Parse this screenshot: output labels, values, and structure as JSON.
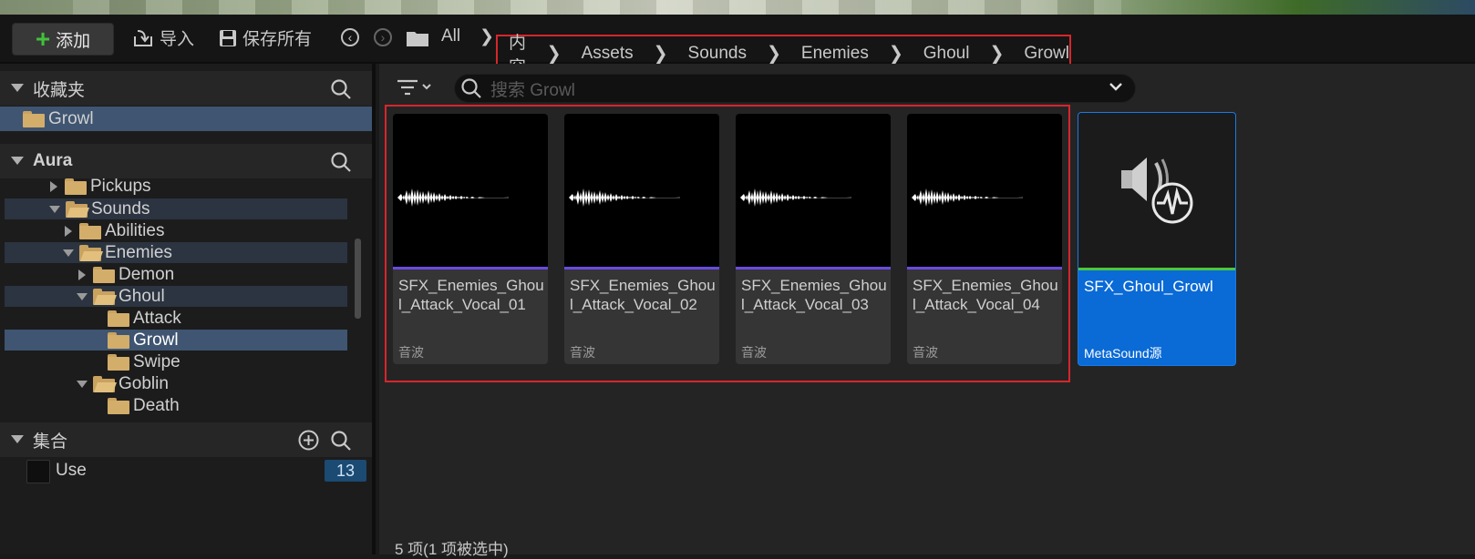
{
  "toolbar": {
    "add_label": "添加",
    "import_label": "导入",
    "save_all_label": "保存所有",
    "all_label": "All"
  },
  "breadcrumb": [
    "内容",
    "Assets",
    "Sounds",
    "Enemies",
    "Ghoul",
    "Growl"
  ],
  "favorites": {
    "title": "收藏夹",
    "items": [
      "Growl"
    ]
  },
  "tree": {
    "title": "Aura",
    "items": [
      {
        "label": "Pickups",
        "depth": 0,
        "state": "collapsed"
      },
      {
        "label": "Sounds",
        "depth": 0,
        "state": "expanded"
      },
      {
        "label": "Abilities",
        "depth": 1,
        "state": "collapsed"
      },
      {
        "label": "Enemies",
        "depth": 1,
        "state": "expanded"
      },
      {
        "label": "Demon",
        "depth": 2,
        "state": "collapsed"
      },
      {
        "label": "Ghoul",
        "depth": 2,
        "state": "expanded"
      },
      {
        "label": "Attack",
        "depth": 3,
        "state": "leaf"
      },
      {
        "label": "Growl",
        "depth": 3,
        "state": "selected"
      },
      {
        "label": "Swipe",
        "depth": 3,
        "state": "leaf"
      },
      {
        "label": "Goblin",
        "depth": 2,
        "state": "expanded"
      },
      {
        "label": "Death",
        "depth": 3,
        "state": "leaf"
      }
    ]
  },
  "collections": {
    "title": "集合",
    "items": [
      {
        "label": "Use",
        "count": "13"
      }
    ]
  },
  "search": {
    "placeholder": "搜索 Growl"
  },
  "assets": [
    {
      "name": "SFX_Enemies_Ghoul_Attack_Vocal_01",
      "type": "音波"
    },
    {
      "name": "SFX_Enemies_Ghoul_Attack_Vocal_02",
      "type": "音波"
    },
    {
      "name": "SFX_Enemies_Ghoul_Attack_Vocal_03",
      "type": "音波"
    },
    {
      "name": "SFX_Enemies_Ghoul_Attack_Vocal_04",
      "type": "音波"
    },
    {
      "name": "SFX_Ghoul_Growl",
      "type": "MetaSound源",
      "selected": true
    }
  ],
  "status": "5 项(1 项被选中)",
  "colors": {
    "highlight_border": "#d7262b",
    "sound_wave_bar": "#6a4be0",
    "metasound_bar": "#4cc83c",
    "selected_tile": "#0a6ad6",
    "selected_row": "#3f5571"
  },
  "icons": [
    "plus-icon",
    "import-icon",
    "save-icon",
    "back-icon",
    "forward-icon",
    "folder-icon",
    "chevron-right-icon",
    "search-icon",
    "filter-icon",
    "chevron-down-icon",
    "add-collection-icon",
    "speaker-waveform-icon"
  ]
}
